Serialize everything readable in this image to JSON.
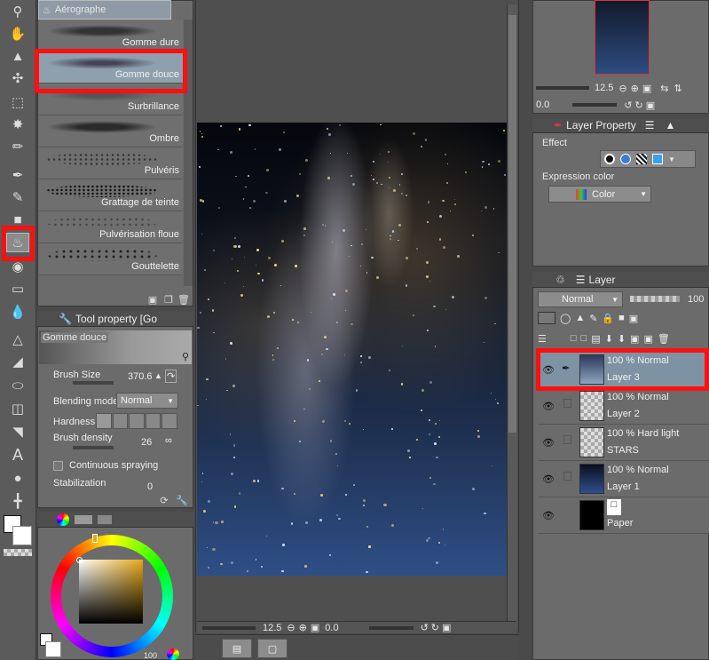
{
  "brush_panel": {
    "title": "Aérographe",
    "brushes": [
      {
        "label": "Gomme dure"
      },
      {
        "label": "Gomme douce"
      },
      {
        "label": "Surbrillance"
      },
      {
        "label": "Ombre"
      },
      {
        "label": "Pulvéris"
      },
      {
        "label": "Grattage de teinte"
      },
      {
        "label": "Pulvérisation floue"
      },
      {
        "label": "Gouttelette"
      }
    ]
  },
  "tool_property": {
    "title": "Tool property [Go",
    "preset_name": "Gomme douce",
    "brush_size_label": "Brush Size",
    "brush_size_value": "370.6",
    "blending_mode_label": "Blending mode",
    "blending_mode_value": "Normal",
    "hardness_label": "Hardness",
    "brush_density_label": "Brush density",
    "brush_density_value": "26",
    "continuous_spraying_label": "Continuous spraying",
    "stabilization_label": "Stabilization",
    "stabilization_value": "0"
  },
  "canvas": {
    "zoom": "12.5",
    "rotation": "0.0"
  },
  "navigator": {
    "zoom": "12.5",
    "rotation": "0.0"
  },
  "layer_property": {
    "tab_label": "Layer Property",
    "effect_label": "Effect",
    "expression_color_label": "Expression color",
    "expression_color_value": "Color"
  },
  "layer_panel": {
    "tab_label": "Layer",
    "blend_mode": "Normal",
    "opacity": "100",
    "layers": [
      {
        "mode": "100 % Normal",
        "name": "Layer 3",
        "selected": true
      },
      {
        "mode": "100 % Normal",
        "name": "Layer 2",
        "selected": false
      },
      {
        "mode": "100 % Hard light",
        "name": "STARS",
        "selected": false
      },
      {
        "mode": "100 % Normal",
        "name": "Layer 1",
        "selected": false
      },
      {
        "mode": "",
        "name": "Paper",
        "selected": false
      }
    ]
  },
  "color": {
    "bottom_value": "100"
  },
  "colors": {
    "highlight_red": "#ff1010",
    "panel_bg": "#6b6b6b",
    "selected_row": "#7d93a3"
  }
}
